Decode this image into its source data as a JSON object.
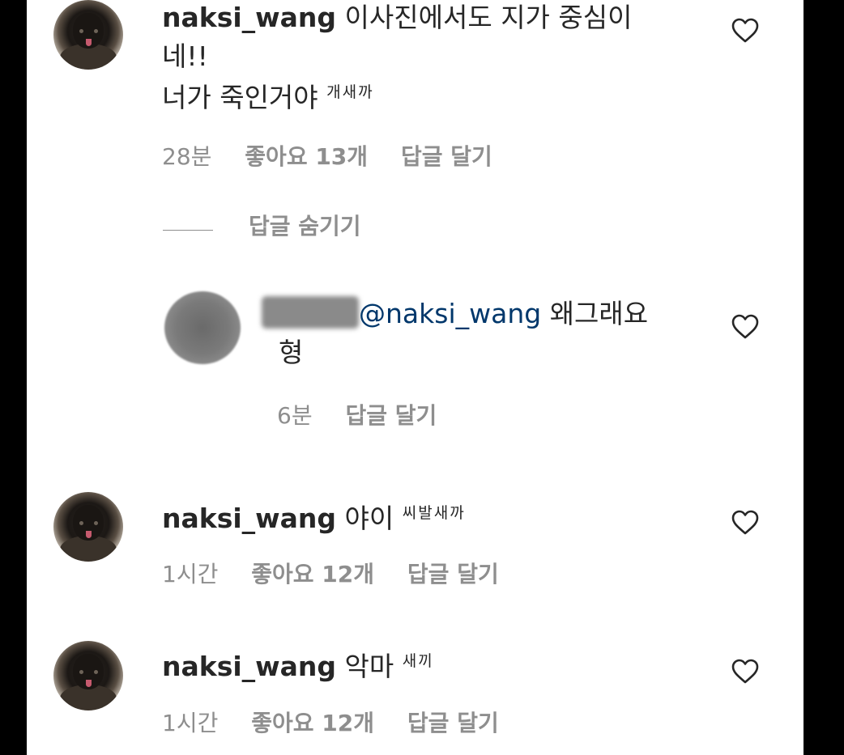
{
  "comments": [
    {
      "username": "naksi_wang",
      "text_line1": "이사진에서도 지가 중심이",
      "text_line2": "네!!",
      "text_line3": "너가 죽인거야",
      "censored": "개새까",
      "time": "28분",
      "likes": "좋아요 13개",
      "reply": "답글 달기"
    },
    {
      "mention": "@naksi_wang",
      "text_line1": "왜그래요",
      "text_line2": "형",
      "time": "6분",
      "reply": "답글 달기"
    },
    {
      "username": "naksi_wang",
      "text": "야이",
      "censored": "씨발새까",
      "time": "1시간",
      "likes": "좋아요 12개",
      "reply": "답글 달기"
    },
    {
      "username": "naksi_wang",
      "text": "악마",
      "censored": "새끼",
      "time": "1시간",
      "likes": "좋아요 12개",
      "reply": "답글 달기"
    }
  ],
  "hide_replies": "답글 숨기기",
  "icons": {
    "like": "heart-outline-icon"
  },
  "colors": {
    "text": "#262626",
    "meta": "#8e8e8e",
    "mention": "#00376b"
  }
}
